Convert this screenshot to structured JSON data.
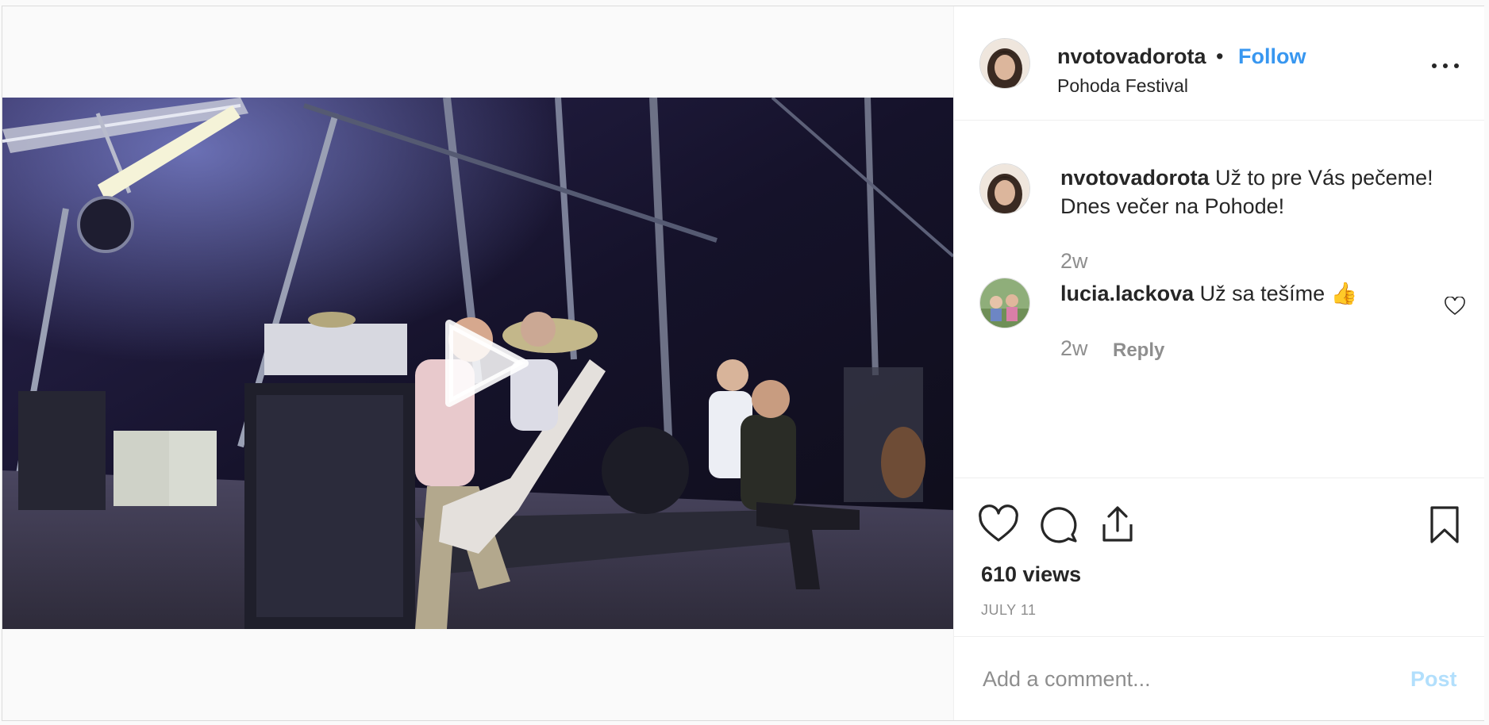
{
  "post": {
    "username": "nvotovadorota",
    "separator": "•",
    "follow_label": "Follow",
    "location": "Pohoda Festival",
    "more_icon": "more-options-icon"
  },
  "caption": {
    "username": "nvotovadorota",
    "text": " Už to pre Vás pečeme! Dnes večer na Pohode!",
    "time": "2w"
  },
  "comments": [
    {
      "username": "lucia.lackova",
      "text": " Už sa tešíme 👍",
      "time": "2w",
      "reply_label": "Reply"
    }
  ],
  "actions": {
    "icons": [
      "heart-icon",
      "comment-icon",
      "share-icon",
      "bookmark-icon"
    ],
    "views": "610 views",
    "date": "JULY 11"
  },
  "add_comment": {
    "placeholder": "Add a comment...",
    "post_label": "Post"
  },
  "colors": {
    "accent": "#3897f0",
    "muted": "#8e8e8e",
    "post_disabled": "#b2dffc"
  },
  "media": {
    "type": "video",
    "play_icon": "play-icon"
  }
}
